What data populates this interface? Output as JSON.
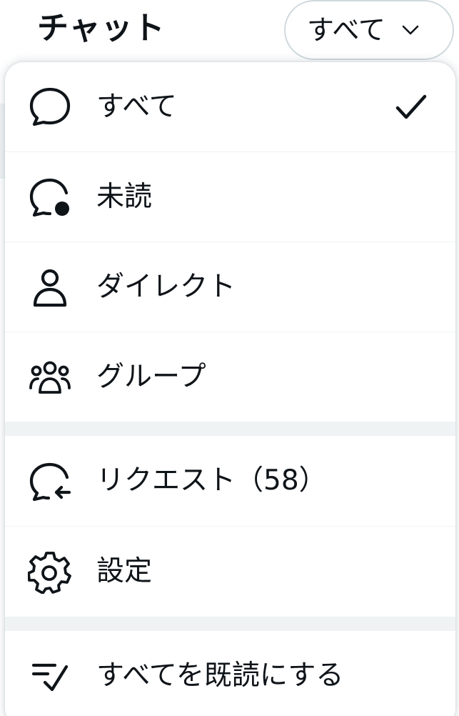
{
  "header": {
    "title": "チャット",
    "filter_label": "すべて"
  },
  "menu": {
    "items": [
      {
        "label": "すべて",
        "icon": "chat-bubble-icon",
        "checked": true
      },
      {
        "label": "未読",
        "icon": "unread-chat-icon"
      },
      {
        "label": "ダイレクト",
        "icon": "person-icon"
      },
      {
        "label": "グループ",
        "icon": "group-icon"
      },
      {
        "label": "リクエスト（58）",
        "icon": "request-chat-icon"
      },
      {
        "label": "設定",
        "icon": "gear-icon"
      },
      {
        "label": "すべてを既読にする",
        "icon": "mark-read-icon"
      }
    ]
  },
  "colors": {
    "text": "#0f1419",
    "border": "#cfd9de",
    "separator": "#eff3f4",
    "muted": "#536471"
  }
}
